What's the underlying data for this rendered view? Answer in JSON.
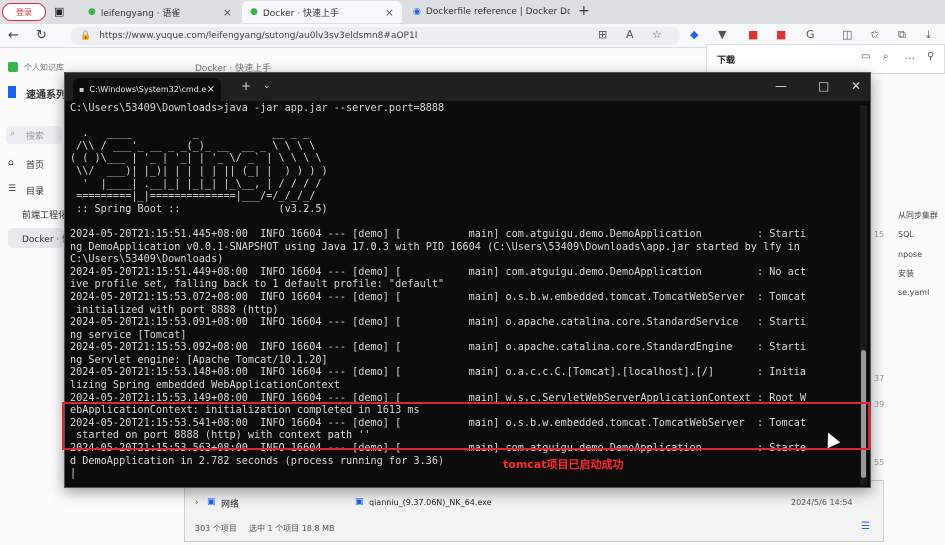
{
  "browser": {
    "login_label": "登录",
    "tabs": [
      {
        "label": "leifengyang · 语雀"
      },
      {
        "label": "Docker · 快速上手"
      },
      {
        "label": "Dockerfile reference | Docker Do"
      }
    ],
    "new_tab": "+",
    "url": "https://www.yuque.com/leifengyang/sutong/au0lv3sv3eldsmn8#aOP1I"
  },
  "downloads": {
    "title": "下载"
  },
  "yuque": {
    "breadcrumb_space": "个人知识库",
    "doc_title_crumb": "Docker · 快速上手",
    "kb_title": "速通系列",
    "search_placeholder": "搜索",
    "nav_home": "首页",
    "nav_toc": "目录",
    "item_frontend": "前端工程化",
    "item_docker": "Docker · 快",
    "right_items": [
      "从同步集群",
      "SQL",
      "npose",
      "安装",
      "se.yaml"
    ],
    "right_numbers": [
      "15",
      "37",
      "39",
      "55"
    ]
  },
  "explorer": {
    "network": "网络",
    "file_name": "qianniu_(9.37.06N)_NK_64.exe",
    "file_date": "2024/5/6 14:54",
    "status_count": "303 个项目",
    "status_selected": "选中 1 个项目  18.8 MB"
  },
  "terminal": {
    "tab_title": "C:\\Windows\\System32\\cmd.e",
    "lines": [
      "C:\\Users\\53409\\Downloads>java -jar app.jar --server.port=8888",
      "",
      "  .   ____          _            __ _ _",
      " /\\\\ / ___'_ __ _ _(_)_ __  __ _ \\ \\ \\ \\",
      "( ( )\\___ | '_ | '_| | '_ \\/ _` | \\ \\ \\ \\",
      " \\\\/  ___)| |_)| | | | | || (_| |  ) ) ) )",
      "  '  |____| .__|_| |_|_| |_\\__, | / / / /",
      " =========|_|==============|___/=/_/_/_/",
      " :: Spring Boot ::                (v3.2.5)",
      "",
      "2024-05-20T21:15:51.445+08:00  INFO 16604 --- [demo] [           main] com.atguigu.demo.DemoApplication         : Starti",
      "ng DemoApplication v0.0.1-SNAPSHOT using Java 17.0.3 with PID 16604 (C:\\Users\\53409\\Downloads\\app.jar started by lfy in",
      "C:\\Users\\53409\\Downloads)",
      "2024-05-20T21:15:51.449+08:00  INFO 16604 --- [demo] [           main] com.atguigu.demo.DemoApplication         : No act",
      "ive profile set, falling back to 1 default profile: \"default\"",
      "2024-05-20T21:15:53.072+08:00  INFO 16604 --- [demo] [           main] o.s.b.w.embedded.tomcat.TomcatWebServer  : Tomcat",
      " initialized with port 8888 (http)",
      "2024-05-20T21:15:53.091+08:00  INFO 16604 --- [demo] [           main] o.apache.catalina.core.StandardService   : Starti",
      "ng service [Tomcat]",
      "2024-05-20T21:15:53.092+08:00  INFO 16604 --- [demo] [           main] o.apache.catalina.core.StandardEngine    : Starti",
      "ng Servlet engine: [Apache Tomcat/10.1.20]",
      "2024-05-20T21:15:53.148+08:00  INFO 16604 --- [demo] [           main] o.a.c.c.C.[Tomcat].[localhost].[/]       : Initia",
      "lizing Spring embedded WebApplicationContext",
      "2024-05-20T21:15:53.149+08:00  INFO 16604 --- [demo] [           main] w.s.c.ServletWebServerApplicationContext : Root W",
      "ebApplicationContext: initialization completed in 1613 ms",
      "2024-05-20T21:15:53.541+08:00  INFO 16604 --- [demo] [           main] o.s.b.w.embedded.tomcat.TomcatWebServer  : Tomcat",
      " started on port 8888 (http) with context path ''",
      "2024-05-20T21:15:53.563+08:00  INFO 16604 --- [demo] [           main] com.atguigu.demo.DemoApplication         : Starte",
      "d DemoApplication in 2.782 seconds (process running for 3.36)",
      "|"
    ]
  },
  "annotation": {
    "text": "tomcat项目已启动成功",
    "color": "#ff2a2a"
  }
}
